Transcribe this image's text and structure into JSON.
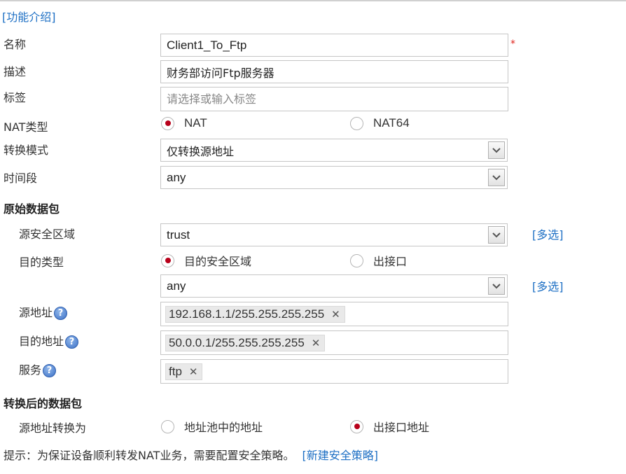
{
  "header": {
    "function_intro_link": "[功能介绍]"
  },
  "form": {
    "name": {
      "label": "名称",
      "value": "Client1_To_Ftp",
      "required_mark": "*"
    },
    "description": {
      "label": "描述",
      "value": "财务部访问Ftp服务器"
    },
    "tags": {
      "label": "标签",
      "placeholder": "请选择或输入标签"
    },
    "nat_type": {
      "label": "NAT类型",
      "options": [
        {
          "label": "NAT",
          "selected": true
        },
        {
          "label": "NAT64",
          "selected": false
        }
      ]
    },
    "convert_mode": {
      "label": "转换模式",
      "value": "仅转换源地址"
    },
    "time_range": {
      "label": "时间段",
      "value": "any"
    }
  },
  "original_packet": {
    "title": "原始数据包",
    "src_zone": {
      "label": "源安全区域",
      "value": "trust",
      "multi_link": "[多选]"
    },
    "dst_type": {
      "label": "目的类型",
      "options": [
        {
          "label": "目的安全区域",
          "selected": true
        },
        {
          "label": "出接口",
          "selected": false
        }
      ],
      "value": "any",
      "multi_link": "[多选]"
    },
    "src_address": {
      "label": "源地址",
      "tags": [
        "192.168.1.1/255.255.255.255"
      ]
    },
    "dst_address": {
      "label": "目的地址",
      "tags": [
        "50.0.0.1/255.255.255.255"
      ]
    },
    "service": {
      "label": "服务",
      "tags": [
        "ftp"
      ]
    }
  },
  "translated_packet": {
    "title": "转换后的数据包",
    "src_convert": {
      "label": "源地址转换为",
      "options": [
        {
          "label": "地址池中的地址",
          "selected": false
        },
        {
          "label": "出接口地址",
          "selected": true
        }
      ]
    }
  },
  "tip": {
    "text": "提示：为保证设备顺利转发NAT业务，需要配置安全策略。",
    "link": "[新建安全策略]"
  },
  "icons": {
    "help": "?",
    "remove": "✕"
  },
  "colors": {
    "accent_link": "#1d6fc4",
    "radio_selected": "#b8001a",
    "required": "#e0241c"
  }
}
